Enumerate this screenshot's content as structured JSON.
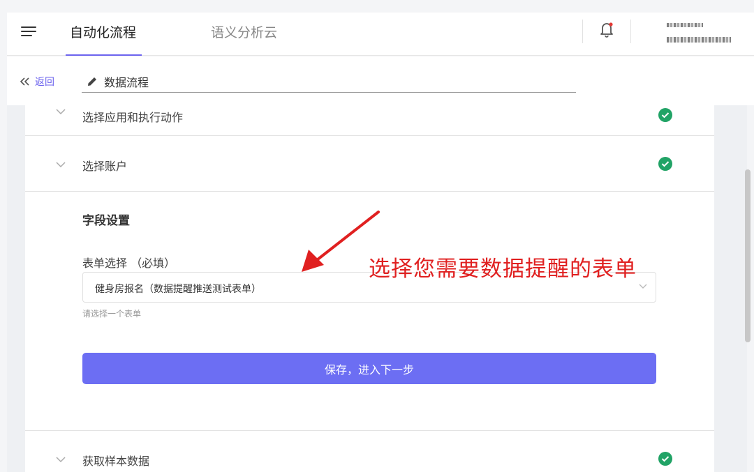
{
  "topbar": {
    "tabs": [
      {
        "label": "自动化流程",
        "active": true
      },
      {
        "label": "语义分析云",
        "active": false
      }
    ],
    "icons": [
      "menu-icon",
      "bell-icon"
    ]
  },
  "subbar": {
    "back_label": "返回",
    "title": "数据流程"
  },
  "steps": {
    "top_partial": "选择应用和执行动作",
    "account": "选择账户",
    "sample": "获取样本数据"
  },
  "form": {
    "section_title": "字段设置",
    "field_label": "表单选择 （必填）",
    "selected_value": "健身房报名（数据提醒推送测试表单）",
    "helper": "请选择一个表单",
    "submit_label": "保存，进入下一步"
  },
  "annotation": {
    "text": "选择您需要数据提醒的表单"
  },
  "colors": {
    "accent": "#6c63ee",
    "button": "#6c6ef3",
    "success": "#21a366",
    "annotation": "#e02020"
  }
}
